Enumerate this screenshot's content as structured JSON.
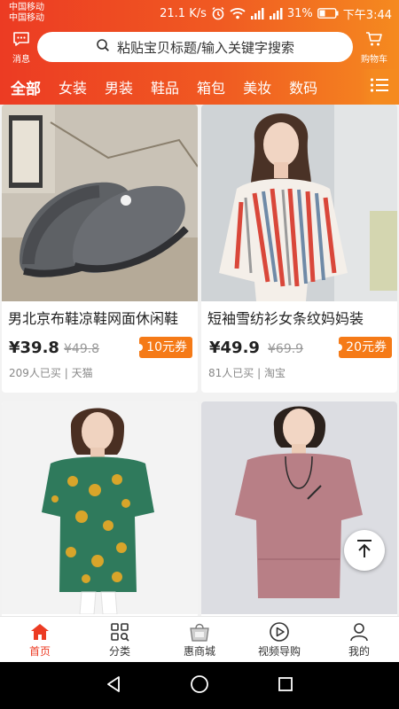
{
  "status_bar": {
    "carrier_1": "中国移动",
    "carrier_2": "中国移动",
    "net_speed": "21.1 K/s",
    "battery": "31%",
    "time": "下午3:44"
  },
  "header": {
    "message_label": "消息",
    "search_placeholder": "粘贴宝贝标题/输入关键字搜索",
    "cart_label": "购物车"
  },
  "tabs": [
    "全部",
    "女装",
    "男装",
    "鞋品",
    "箱包",
    "美妆",
    "数码"
  ],
  "products": [
    {
      "title": "男北京布鞋凉鞋网面休闲鞋",
      "price": "¥39.8",
      "original": "¥49.8",
      "coupon": "10元券",
      "sales": "209人已买",
      "platform": "天猫"
    },
    {
      "title": "短袖雪纺衫女条纹妈妈装",
      "price": "¥49.9",
      "original": "¥69.9",
      "coupon": "20元券",
      "sales": "81人已买",
      "platform": "淘宝"
    },
    {
      "title": "",
      "price": "",
      "original": "",
      "coupon": "",
      "sales": "",
      "platform": ""
    },
    {
      "title": "",
      "price": "",
      "original": "",
      "coupon": "",
      "sales": "",
      "platform": ""
    }
  ],
  "bottom_nav": [
    {
      "label": "首页",
      "icon": "home-icon",
      "active": true
    },
    {
      "label": "分类",
      "icon": "category-icon",
      "active": false
    },
    {
      "label": "惠商城",
      "icon": "mall-icon",
      "active": false
    },
    {
      "label": "视频导购",
      "icon": "video-play-icon",
      "active": false
    },
    {
      "label": "我的",
      "icon": "user-icon",
      "active": false
    }
  ],
  "colors": {
    "brand_red": "#ec3b23",
    "brand_orange": "#f58a1f",
    "coupon_orange": "#f57a17"
  }
}
